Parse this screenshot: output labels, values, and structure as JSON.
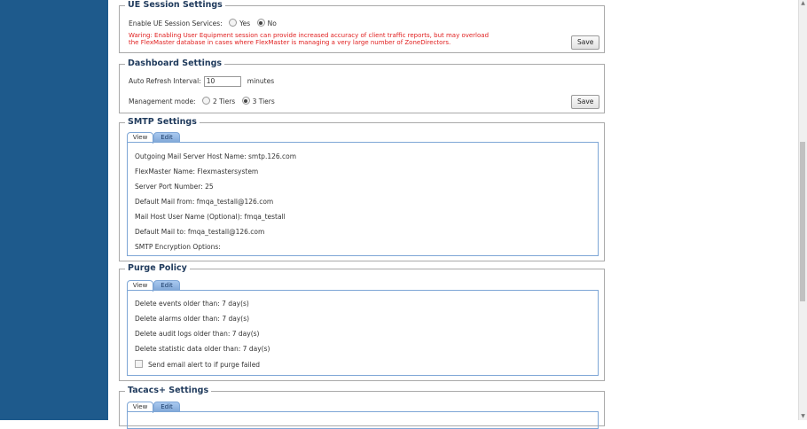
{
  "ue_session": {
    "title": "UE Session Settings",
    "enable_label": "Enable UE Session Services:",
    "yes_label": "Yes",
    "no_label": "No",
    "selected": "No",
    "warning_line1": "Waring: Enabling User Equipment session can provide increased accuracy of client traffic reports, but may overload",
    "warning_line2": "the FlexMaster database in cases where FlexMaster is managing a very large number of ZoneDirectors.",
    "save_label": "Save"
  },
  "dashboard": {
    "title": "Dashboard Settings",
    "refresh_label": "Auto Refresh Interval:",
    "refresh_value": "10",
    "refresh_unit": "minutes",
    "mode_label": "Management mode:",
    "mode_2": "2 Tiers",
    "mode_3": "3 Tiers",
    "selected_mode": "3 Tiers",
    "save_label": "Save"
  },
  "smtp": {
    "title": "SMTP Settings",
    "tab_view": "View",
    "tab_edit": "Edit",
    "rows": [
      "Outgoing Mail Server Host Name: smtp.126.com",
      "FlexMaster Name: Flexmastersystem",
      "Server Port Number: 25",
      "Default Mail from: fmqa_testall@126.com",
      "Mail Host User Name (Optional): fmqa_testall",
      "Default Mail to: fmqa_testall@126.com",
      "SMTP Encryption Options:"
    ]
  },
  "purge": {
    "title": "Purge Policy",
    "tab_view": "View",
    "tab_edit": "Edit",
    "rows": [
      "Delete events older than: 7 day(s)",
      "Delete alarms older than: 7 day(s)",
      "Delete audit logs older than: 7 day(s)",
      "Delete statistic data older than: 7 day(s)"
    ],
    "email_alert_label": "Send email alert to if purge failed",
    "email_alert_checked": false
  },
  "tacacs": {
    "title": "Tacacs+ Settings",
    "tab_view": "View",
    "tab_edit": "Edit"
  },
  "colors": {
    "sidebar": "#1e5a8c",
    "legend_text": "#1f3a5c",
    "warning": "#e02020",
    "tab_border": "#7ea6d6"
  }
}
